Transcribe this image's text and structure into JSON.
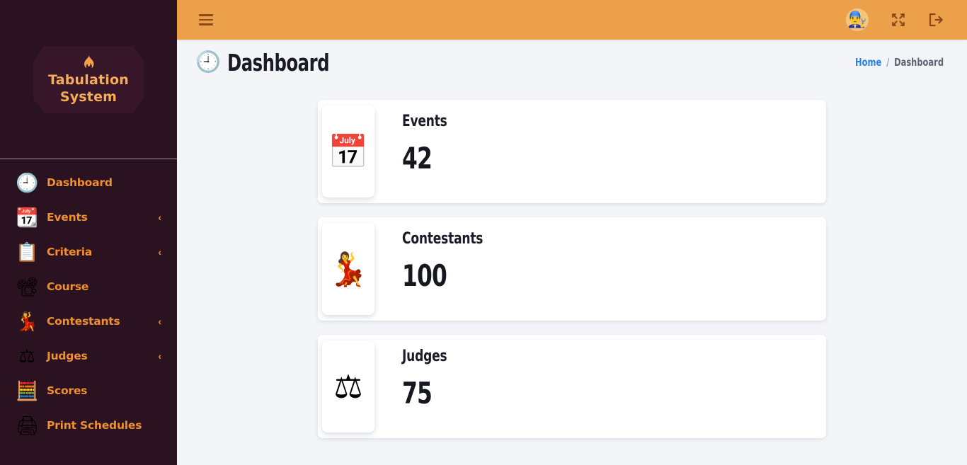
{
  "colors": {
    "sidebar_bg": "#2b1220",
    "sidebar_accent": "#ef8f2d",
    "logo_badge_bg": "#38162a",
    "logo_text": "#f7ad55",
    "topbar_bg": "#eda04a",
    "topbar_icon": "#8a4a18",
    "content_bg": "#f4f5f9",
    "card_bg": "#ffffff",
    "heading_text": "#191b27",
    "breadcrumb_link": "#2a7fe8",
    "breadcrumb_current": "#5d6470"
  },
  "sidebar": {
    "logo": {
      "icon": "flame-icon",
      "line1": "Tabulation",
      "line2": "System"
    },
    "items": [
      {
        "label": "Dashboard",
        "icon": "dashboard-gauge-icon",
        "glyph": "🕘",
        "has_caret": false,
        "caret": "",
        "active": true
      },
      {
        "label": "Events",
        "icon": "calendar-icon",
        "glyph": "📆",
        "has_caret": true,
        "caret": "‹",
        "active": false
      },
      {
        "label": "Criteria",
        "icon": "clipboard-icon",
        "glyph": "📋",
        "has_caret": true,
        "caret": "‹",
        "active": false
      },
      {
        "label": "Course",
        "icon": "presentation-abc-icon",
        "glyph": "📽",
        "has_caret": false,
        "caret": "",
        "active": false
      },
      {
        "label": "Contestants",
        "icon": "woman-dress-icon",
        "glyph": "💃",
        "has_caret": true,
        "caret": "‹",
        "active": false
      },
      {
        "label": "Judges",
        "icon": "gavel-icon",
        "glyph": "⚖",
        "has_caret": true,
        "caret": "‹",
        "active": false
      },
      {
        "label": "Scores",
        "icon": "abacus-counter-icon",
        "glyph": "🧮",
        "has_caret": false,
        "caret": "",
        "active": false
      },
      {
        "label": "Print Schedules",
        "icon": "printer-icon",
        "glyph": "🖨",
        "has_caret": false,
        "caret": "",
        "active": false
      }
    ]
  },
  "topbar": {
    "menu_toggle": "hamburger-menu-icon",
    "avatar": {
      "icon": "user-avatar-icon",
      "glyph": "👨‍🔧"
    },
    "fullscreen": {
      "icon": "fullscreen-expand-icon",
      "label": ""
    },
    "logout": {
      "icon": "logout-icon",
      "label": ""
    }
  },
  "page": {
    "title": "Dashboard",
    "title_icon": "dashboard-gauge-icon",
    "title_glyph": "🕘",
    "breadcrumb": {
      "home": "Home",
      "separator": "/",
      "current": "Dashboard"
    }
  },
  "cards": [
    {
      "label": "Events",
      "value": "42",
      "icon": "calendar-icon",
      "glyph": "📅"
    },
    {
      "label": "Contestants",
      "value": "100",
      "icon": "woman-dress-icon",
      "glyph": "💃"
    },
    {
      "label": "Judges",
      "value": "75",
      "icon": "gavel-icon",
      "glyph": "⚖"
    }
  ]
}
